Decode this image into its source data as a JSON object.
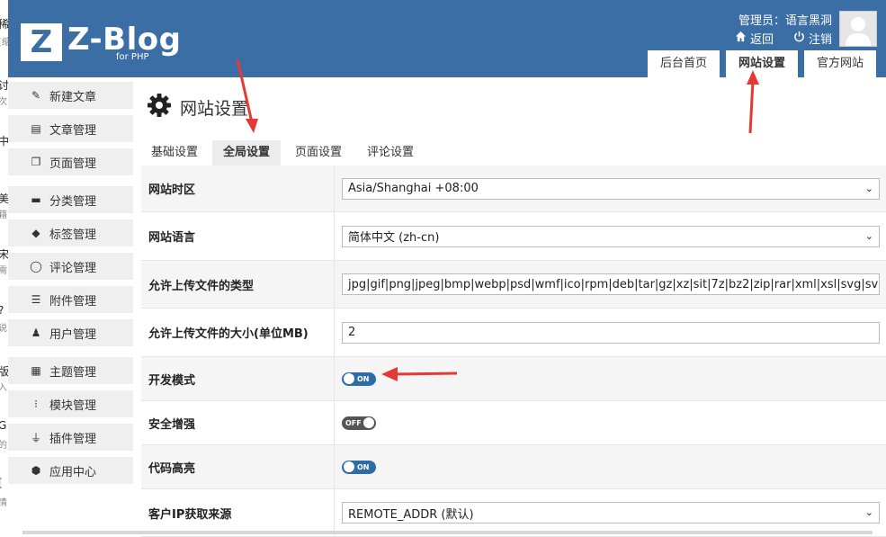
{
  "bg_fragments": [
    "稀",
    "[缩",
    "讨",
    "次",
    "中",
    "美",
    "籍",
    "宋",
    "需",
    "?",
    "说",
    "版",
    "入",
    "G",
    "的",
    "[",
    "情"
  ],
  "header": {
    "logo_letter": "Z",
    "logo_text": "Z-Blog",
    "logo_sub": "for PHP",
    "user_label": "管理员：语言黑洞",
    "back_label": "返回",
    "logout_label": "注销",
    "tabs": [
      {
        "label": "后台首页",
        "active": false
      },
      {
        "label": "网站设置",
        "active": true
      },
      {
        "label": "官方网站",
        "active": false
      }
    ]
  },
  "sidebar": {
    "items": [
      {
        "label": "新建文章",
        "icon": "edit-icon"
      },
      {
        "label": "文章管理",
        "icon": "document-icon"
      },
      {
        "label": "页面管理",
        "icon": "pages-icon"
      },
      {
        "label": "分类管理",
        "icon": "folder-icon"
      },
      {
        "label": "标签管理",
        "icon": "tag-icon"
      },
      {
        "label": "评论管理",
        "icon": "comment-icon"
      },
      {
        "label": "附件管理",
        "icon": "attachment-icon"
      },
      {
        "label": "用户管理",
        "icon": "user-icon"
      },
      {
        "label": "主题管理",
        "icon": "theme-icon"
      },
      {
        "label": "模块管理",
        "icon": "module-icon"
      },
      {
        "label": "插件管理",
        "icon": "plugin-icon"
      },
      {
        "label": "应用中心",
        "icon": "app-center-icon"
      }
    ]
  },
  "main": {
    "title": "网站设置",
    "tabs": [
      {
        "label": "基础设置",
        "active": false
      },
      {
        "label": "全局设置",
        "active": true
      },
      {
        "label": "页面设置",
        "active": false
      },
      {
        "label": "评论设置",
        "active": false
      }
    ],
    "settings": [
      {
        "label": "网站时区",
        "type": "select",
        "value": "Asia/Shanghai +08:00"
      },
      {
        "label": "网站语言",
        "type": "select",
        "value": "简体中文 (zh-cn)"
      },
      {
        "label": "允许上传文件的类型",
        "type": "text",
        "value": "jpg|gif|png|jpeg|bmp|webp|psd|wmf|ico|rpm|deb|tar|gz|xz|sit|7z|bz2|zip|rar|xml|xsl|svg|svgz|rtf|doc"
      },
      {
        "label": "允许上传文件的大小(单位MB)",
        "type": "text",
        "value": "2"
      },
      {
        "label": "开发模式",
        "type": "toggle",
        "value": "ON"
      },
      {
        "label": "安全增强",
        "type": "toggle",
        "value": "OFF"
      },
      {
        "label": "代码高亮",
        "type": "toggle",
        "value": "ON"
      },
      {
        "label": "客户IP获取来源",
        "type": "select",
        "value": "REMOTE_ADDR (默认)"
      }
    ]
  },
  "colors": {
    "header": "#3a6ea5",
    "toggle_on": "#2e6ca8",
    "toggle_off": "#555555",
    "arrow": "#e53935"
  }
}
